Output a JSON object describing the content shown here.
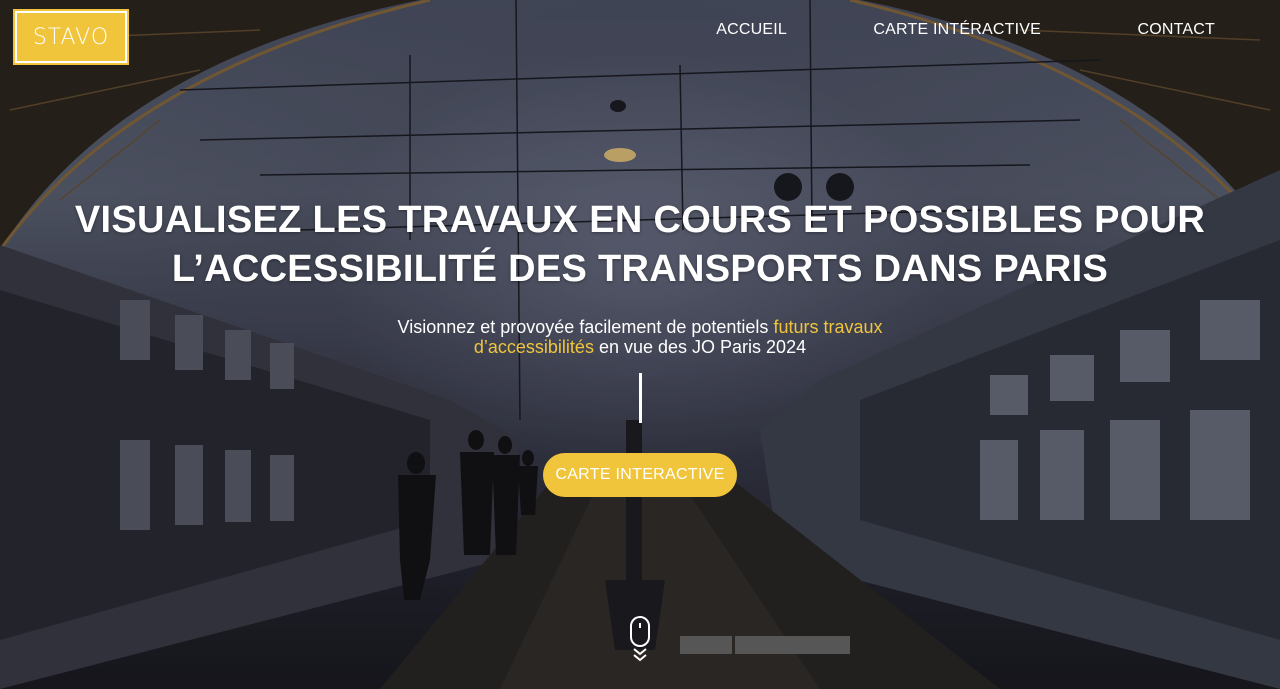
{
  "brand": {
    "logo_text": "STAVO",
    "accent_color": "#f0c53c"
  },
  "nav": {
    "items": [
      {
        "label": "ACCUEIL"
      },
      {
        "label": "CARTE INTÉRACTIVE"
      },
      {
        "label": "CONTACT"
      }
    ]
  },
  "hero": {
    "title_line1": "VISUALISEZ LES TRAVAUX EN COURS ET POSSIBLES POUR",
    "title_line2": "L’ACCESSIBILITÉ DES TRANSPORTS DANS PARIS",
    "subtitle_part1": "Visionnez et provoyée facilement de potentiels",
    "subtitle_highlight": "futurs travaux d’accessibilités",
    "subtitle_part2": "en vue des JO Paris 2024",
    "cta_label": "CARTE INTERACTIVE"
  },
  "icons": {
    "scroll": "mouse-scroll-icon",
    "chevrons": "double-chevron-down-icon"
  }
}
